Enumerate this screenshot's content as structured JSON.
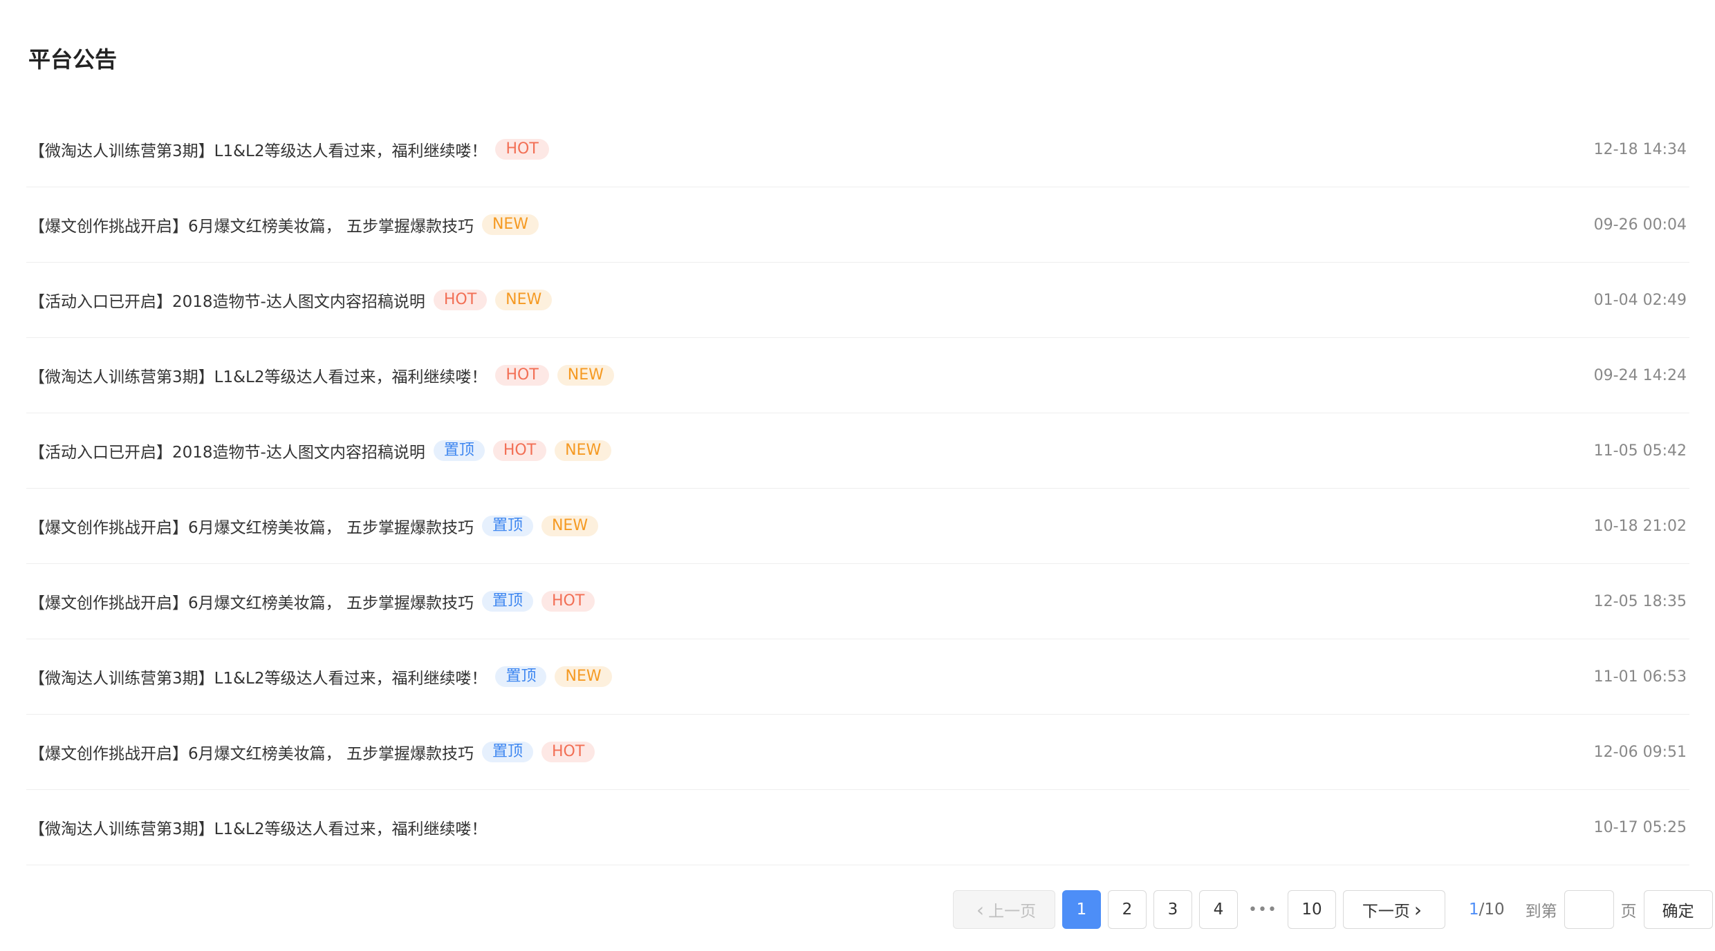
{
  "title": "平台公告",
  "announcements": [
    {
      "title": "【微淘达人训练营第3期】L1&L2等级达人看过来，福利继续喽！",
      "tags": [
        {
          "text": "HOT",
          "type": "hot"
        }
      ],
      "time": "12-18 14:34"
    },
    {
      "title": "【爆文创作挑战开启】6月爆文红榜美妆篇， 五步掌握爆款技巧",
      "tags": [
        {
          "text": "NEW",
          "type": "new"
        }
      ],
      "time": "09-26 00:04"
    },
    {
      "title": "【活动入口已开启】2018造物节-达人图文内容招稿说明",
      "tags": [
        {
          "text": "HOT",
          "type": "hot"
        },
        {
          "text": "NEW",
          "type": "new"
        }
      ],
      "time": "01-04 02:49"
    },
    {
      "title": "【微淘达人训练营第3期】L1&L2等级达人看过来，福利继续喽！",
      "tags": [
        {
          "text": "HOT",
          "type": "hot"
        },
        {
          "text": "NEW",
          "type": "new"
        }
      ],
      "time": "09-24 14:24"
    },
    {
      "title": "【活动入口已开启】2018造物节-达人图文内容招稿说明",
      "tags": [
        {
          "text": "置顶",
          "type": "top"
        },
        {
          "text": "HOT",
          "type": "hot"
        },
        {
          "text": "NEW",
          "type": "new"
        }
      ],
      "time": "11-05 05:42"
    },
    {
      "title": "【爆文创作挑战开启】6月爆文红榜美妆篇， 五步掌握爆款技巧",
      "tags": [
        {
          "text": "置顶",
          "type": "top"
        },
        {
          "text": "NEW",
          "type": "new"
        }
      ],
      "time": "10-18 21:02"
    },
    {
      "title": "【爆文创作挑战开启】6月爆文红榜美妆篇， 五步掌握爆款技巧",
      "tags": [
        {
          "text": "置顶",
          "type": "top"
        },
        {
          "text": "HOT",
          "type": "hot"
        }
      ],
      "time": "12-05 18:35"
    },
    {
      "title": "【微淘达人训练营第3期】L1&L2等级达人看过来，福利继续喽！",
      "tags": [
        {
          "text": "置顶",
          "type": "top"
        },
        {
          "text": "NEW",
          "type": "new"
        }
      ],
      "time": "11-01 06:53"
    },
    {
      "title": "【爆文创作挑战开启】6月爆文红榜美妆篇， 五步掌握爆款技巧",
      "tags": [
        {
          "text": "置顶",
          "type": "top"
        },
        {
          "text": "HOT",
          "type": "hot"
        }
      ],
      "time": "12-06 09:51"
    },
    {
      "title": "【微淘达人训练营第3期】L1&L2等级达人看过来，福利继续喽！",
      "tags": [],
      "time": "10-17 05:25"
    }
  ],
  "pagination": {
    "prev_label": "上一页",
    "next_label": "下一页",
    "pages": [
      "1",
      "2",
      "3",
      "4"
    ],
    "ellipsis": "•••",
    "last_page": "10",
    "current": "1",
    "total_suffix": "/10",
    "goto_label": "到第",
    "goto_value": "",
    "page_label": "页",
    "confirm_label": "确定"
  },
  "colors": {
    "accent": "#4d8ef7",
    "hot": "#f26f55",
    "new": "#f59a23",
    "top": "#3d86f0"
  }
}
